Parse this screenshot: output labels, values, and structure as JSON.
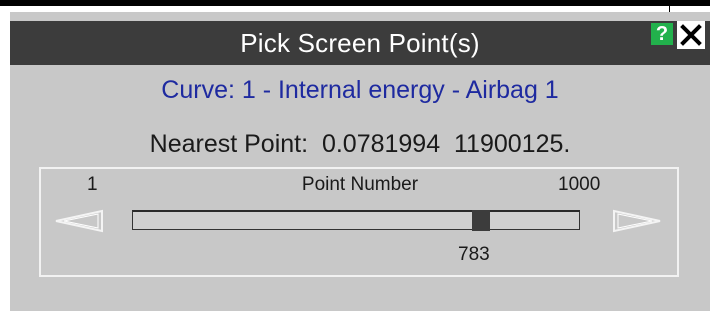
{
  "dialog": {
    "title": "Pick Screen Point(s)",
    "help_label": "?",
    "curve_label": "Curve: 1 - Internal energy - Airbag 1",
    "nearest_point": "Nearest Point:  0.0781994  11900125."
  },
  "slider": {
    "title": "Point Number",
    "min_label": "1",
    "max_label": "1000",
    "min": 1,
    "max": 1000,
    "value": 783,
    "value_label": "783"
  },
  "icons": {
    "help": "question-icon",
    "close": "close-icon",
    "prev": "left-arrow-icon",
    "next": "right-arrow-icon"
  },
  "colors": {
    "titlebar": "#3c3c3c",
    "panel": "#c8c8c8",
    "curve_text": "#1e2aa0",
    "help_button": "#22b14c"
  }
}
